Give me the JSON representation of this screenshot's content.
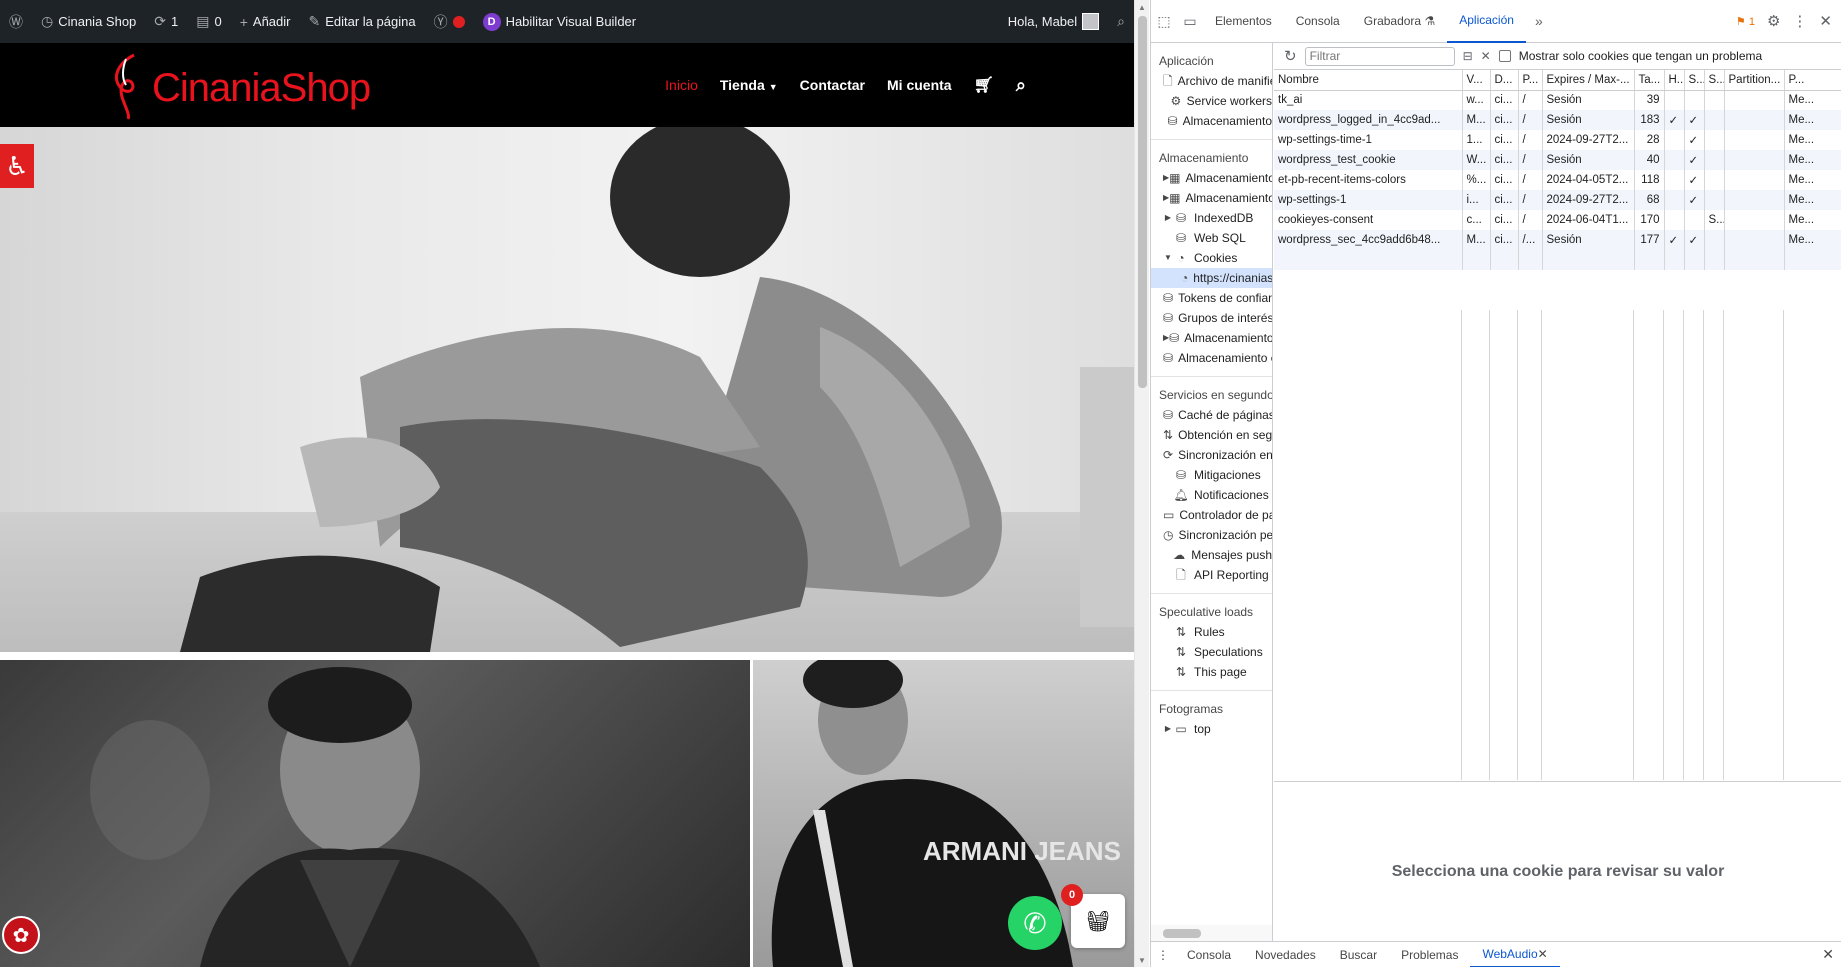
{
  "admin_bar": {
    "site_name": "Cinania Shop",
    "updates_count": "1",
    "comments_count": "0",
    "add_label": "Añadir",
    "edit_label": "Editar la página",
    "builder_label": "Habilitar Visual Builder",
    "greeting": "Hola, Mabel"
  },
  "site": {
    "logo_text": "CinaniaShop",
    "nav": [
      "Inicio",
      "Tienda",
      "Contactar",
      "Mi cuenta"
    ],
    "cart_count": "0",
    "brand_color": "#e8131d",
    "hero_image_text": "ARMANI JEANS"
  },
  "devtools": {
    "tabs": [
      "Elementos",
      "Consola",
      "Grabadora",
      "Aplicación"
    ],
    "selected_tab": "Aplicación",
    "issues_count": "1",
    "sidebar": {
      "sections": [
        {
          "title": "Aplicación",
          "items": [
            {
              "label": "Archivo de manifiesto",
              "icon": "file-icon",
              "arrow": ""
            },
            {
              "label": "Service workers",
              "icon": "gear-icon",
              "arrow": ""
            },
            {
              "label": "Almacenamiento",
              "icon": "database-icon",
              "arrow": ""
            }
          ]
        },
        {
          "title": "Almacenamiento",
          "items": [
            {
              "label": "Almacenamiento local",
              "icon": "table-icon",
              "arrow": "▶"
            },
            {
              "label": "Almacenamiento de sesión",
              "icon": "table-icon",
              "arrow": "▶"
            },
            {
              "label": "IndexedDB",
              "icon": "database-icon",
              "arrow": "▶"
            },
            {
              "label": "Web SQL",
              "icon": "database-icon",
              "arrow": ""
            },
            {
              "label": "Cookies",
              "icon": "cookie-icon",
              "arrow": "▼"
            },
            {
              "label": "https://cinaniashop.com",
              "icon": "cookie-icon",
              "arrow": "",
              "child": true,
              "selected": true
            },
            {
              "label": "Tokens de confianza",
              "icon": "database-icon",
              "arrow": ""
            },
            {
              "label": "Grupos de interés",
              "icon": "database-icon",
              "arrow": ""
            },
            {
              "label": "Almacenamiento compartido",
              "icon": "database-icon",
              "arrow": "▶"
            },
            {
              "label": "Almacenamiento en caché",
              "icon": "database-icon",
              "arrow": ""
            }
          ]
        },
        {
          "title": "Servicios en segundo plano",
          "items": [
            {
              "label": "Caché de páginas",
              "icon": "database-icon",
              "arrow": ""
            },
            {
              "label": "Obtención en segundo plano",
              "icon": "updown-icon",
              "arrow": ""
            },
            {
              "label": "Sincronización en segundo plano",
              "icon": "sync-icon",
              "arrow": ""
            },
            {
              "label": "Mitigaciones",
              "icon": "database-icon",
              "arrow": ""
            },
            {
              "label": "Notificaciones",
              "icon": "bell-icon",
              "arrow": ""
            },
            {
              "label": "Controlador de pagos",
              "icon": "card-icon",
              "arrow": ""
            },
            {
              "label": "Sincronización periódica",
              "icon": "clock-icon",
              "arrow": ""
            },
            {
              "label": "Mensajes push",
              "icon": "cloud-icon",
              "arrow": ""
            },
            {
              "label": "API Reporting",
              "icon": "file-icon",
              "arrow": ""
            }
          ]
        },
        {
          "title": "Speculative loads",
          "items": [
            {
              "label": "Rules",
              "icon": "updown-icon",
              "arrow": ""
            },
            {
              "label": "Speculations",
              "icon": "updown-icon",
              "arrow": ""
            },
            {
              "label": "This page",
              "icon": "updown-icon",
              "arrow": ""
            }
          ]
        },
        {
          "title": "Fotogramas",
          "items": [
            {
              "label": "top",
              "icon": "frame-icon",
              "arrow": "▶"
            }
          ]
        }
      ]
    },
    "filter_placeholder": "Filtrar",
    "only_issues_label": "Mostrar solo cookies que tengan un problema",
    "columns": [
      "Nombre",
      "V...",
      "D...",
      "P...",
      "Expires / Max-...",
      "Ta...",
      "H...",
      "S...",
      "S...",
      "Partition...",
      "P..."
    ],
    "rows": [
      [
        "tk_ai",
        "w...",
        "ci...",
        "/",
        "Sesión",
        "39",
        "",
        "",
        "",
        "",
        "Me..."
      ],
      [
        "wordpress_logged_in_4cc9ad...",
        "M...",
        "ci...",
        "/",
        "Sesión",
        "183",
        "✓",
        "✓",
        "",
        "",
        "Me..."
      ],
      [
        "wp-settings-time-1",
        "1...",
        "ci...",
        "/",
        "2024-09-27T2...",
        "28",
        "",
        "✓",
        "",
        "",
        "Me..."
      ],
      [
        "wordpress_test_cookie",
        "W...",
        "ci...",
        "/",
        "Sesión",
        "40",
        "",
        "✓",
        "",
        "",
        "Me..."
      ],
      [
        "et-pb-recent-items-colors",
        "%...",
        "ci...",
        "/",
        "2024-04-05T2...",
        "118",
        "",
        "✓",
        "",
        "",
        "Me..."
      ],
      [
        "wp-settings-1",
        "i...",
        "ci...",
        "/",
        "2024-09-27T2...",
        "68",
        "",
        "✓",
        "",
        "",
        "Me..."
      ],
      [
        "cookieyes-consent",
        "c...",
        "ci...",
        "/",
        "2024-06-04T1...",
        "170",
        "",
        "",
        "S...",
        "",
        "Me..."
      ],
      [
        "wordpress_sec_4cc9add6b48...",
        "M...",
        "ci...",
        "/...",
        "Sesión",
        "177",
        "✓",
        "✓",
        "",
        "",
        "Me..."
      ]
    ],
    "empty_message": "Selecciona una cookie para revisar su valor",
    "drawer_tabs": [
      "Consola",
      "Novedades",
      "Buscar",
      "Problemas",
      "WebAudio"
    ],
    "drawer_selected": "WebAudio"
  }
}
